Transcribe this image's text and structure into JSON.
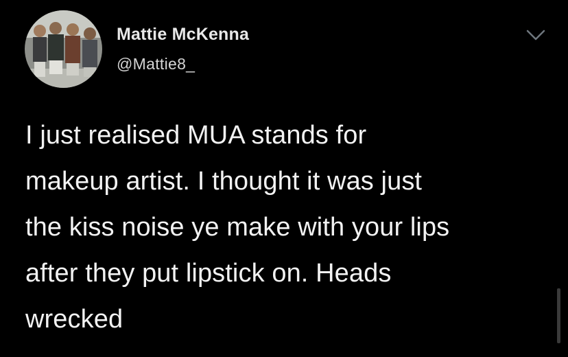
{
  "tweet": {
    "author_name": "Mattie McKenna",
    "author_handle": "@Mattie8_",
    "avatar_icon": "profile-photo-group",
    "menu_icon": "chevron-down-icon",
    "text_lines": [
      "I just realised MUA stands for",
      "makeup artist. I thought it was just",
      "the kiss noise ye make with your lips",
      "after they put lipstick on. Heads",
      "wrecked"
    ]
  },
  "colors": {
    "background": "#000000",
    "name": "#e8e8e8",
    "handle": "#d4d4d4",
    "body": "#f2f2f2",
    "caret": "#6e767d"
  }
}
